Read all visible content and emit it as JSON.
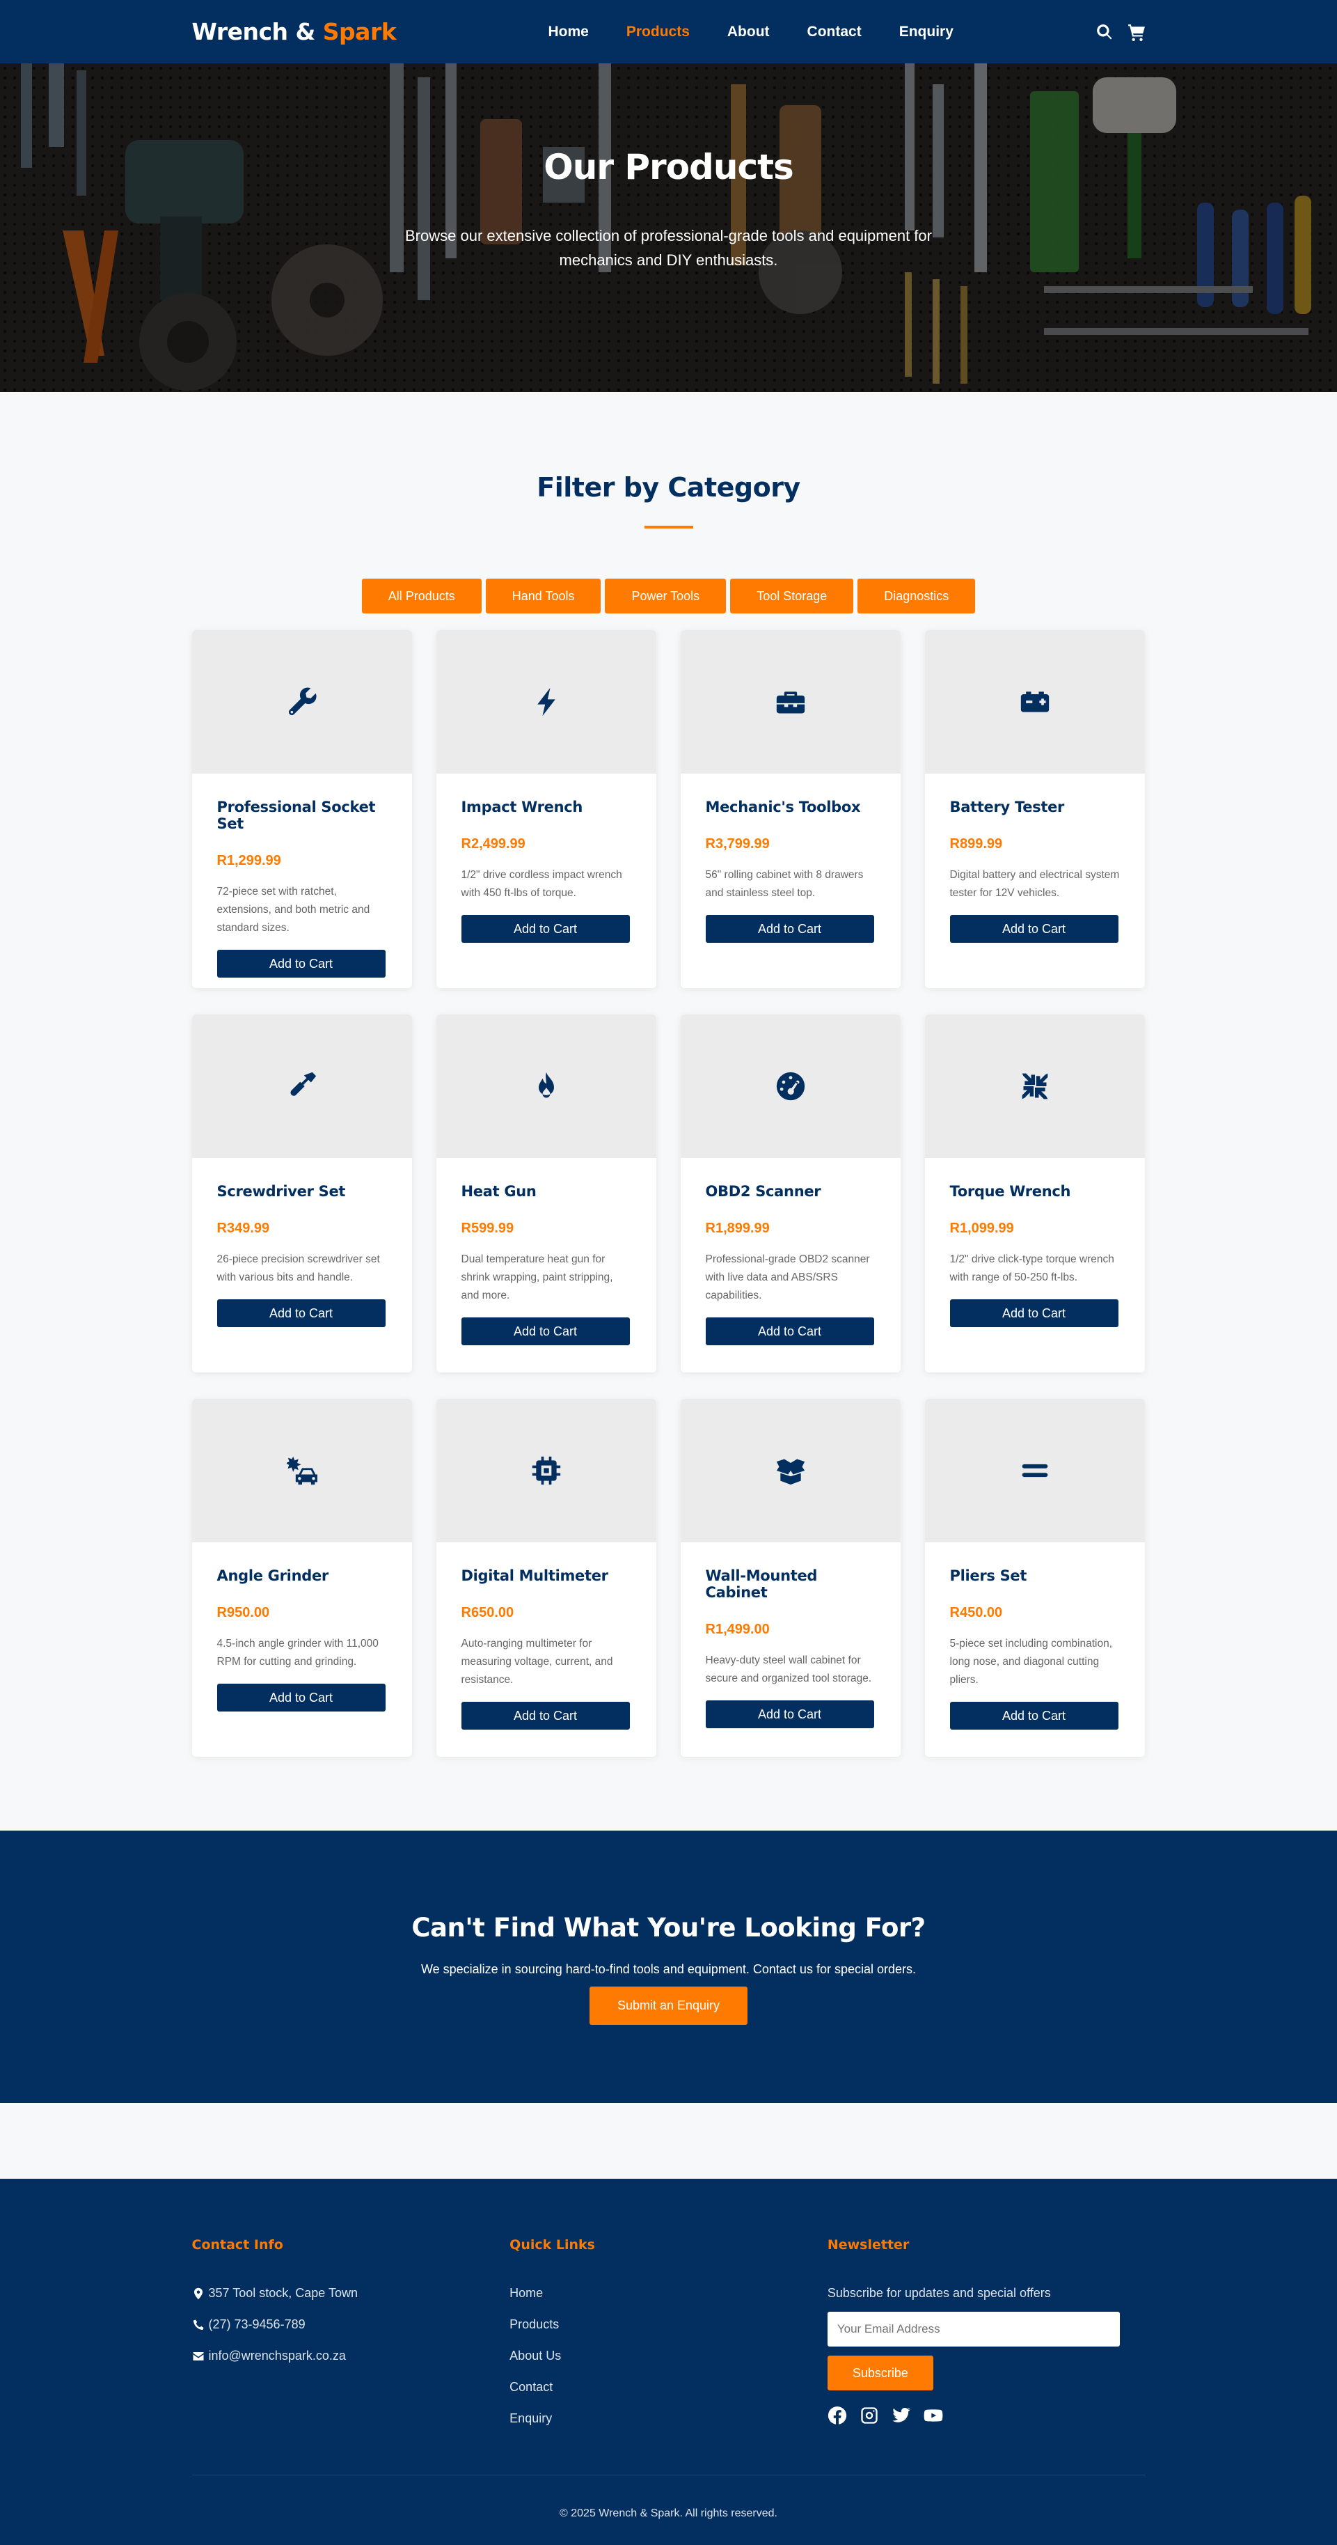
{
  "brand": {
    "name_part1": "Wrench & ",
    "name_part2": "Spark"
  },
  "nav": {
    "items": [
      {
        "label": "Home"
      },
      {
        "label": "Products"
      },
      {
        "label": "About"
      },
      {
        "label": "Contact"
      },
      {
        "label": "Enquiry"
      }
    ],
    "active": "Products"
  },
  "hero": {
    "title": "Our Products",
    "subtitle": "Browse our extensive collection of professional-grade tools and equipment for mechanics and DIY enthusiasts."
  },
  "filter": {
    "title": "Filter by Category",
    "buttons": [
      "All Products",
      "Hand Tools",
      "Power Tools",
      "Tool Storage",
      "Diagnostics"
    ]
  },
  "products": [
    {
      "name": "Professional Socket Set",
      "price": "R1,299.99",
      "desc": "72-piece set with ratchet, extensions, and both metric and standard sizes.",
      "icon": "wrench-icon",
      "button": "Add to Cart"
    },
    {
      "name": "Impact Wrench",
      "price": "R2,499.99",
      "desc": "1/2\" drive cordless impact wrench with 450 ft-lbs of torque.",
      "icon": "bolt-icon",
      "button": "Add to Cart"
    },
    {
      "name": "Mechanic's Toolbox",
      "price": "R3,799.99",
      "desc": "56\" rolling cabinet with 8 drawers and stainless steel top.",
      "icon": "toolbox-icon",
      "button": "Add to Cart"
    },
    {
      "name": "Battery Tester",
      "price": "R899.99",
      "desc": "Digital battery and electrical system tester for 12V vehicles.",
      "icon": "car-battery-icon",
      "button": "Add to Cart"
    },
    {
      "name": "Screwdriver Set",
      "price": "R349.99",
      "desc": "26-piece precision screwdriver set with various bits and handle.",
      "icon": "screwdriver-icon",
      "button": "Add to Cart"
    },
    {
      "name": "Heat Gun",
      "price": "R599.99",
      "desc": "Dual temperature heat gun for shrink wrapping, paint stripping, and more.",
      "icon": "fire-icon",
      "button": "Add to Cart"
    },
    {
      "name": "OBD2 Scanner",
      "price": "R1,899.99",
      "desc": "Professional-grade OBD2 scanner with live data and ABS/SRS capabilities.",
      "icon": "gauge-icon",
      "button": "Add to Cart"
    },
    {
      "name": "Torque Wrench",
      "price": "R1,099.99",
      "desc": "1/2\" drive click-type torque wrench with range of 50-250 ft-lbs.",
      "icon": "compress-icon",
      "button": "Add to Cart"
    },
    {
      "name": "Angle Grinder",
      "price": "R950.00",
      "desc": "4.5-inch angle grinder with 11,000 RPM for cutting and grinding.",
      "icon": "car-burst-icon",
      "button": "Add to Cart"
    },
    {
      "name": "Digital Multimeter",
      "price": "R650.00",
      "desc": "Auto-ranging multimeter for measuring voltage, current, and resistance.",
      "icon": "microchip-icon",
      "button": "Add to Cart"
    },
    {
      "name": "Wall-Mounted Cabinet",
      "price": "R1,499.00",
      "desc": "Heavy-duty steel wall cabinet for secure and organized tool storage.",
      "icon": "box-open-icon",
      "button": "Add to Cart"
    },
    {
      "name": "Pliers Set",
      "price": "R450.00",
      "desc": "5-piece set including combination, long nose, and diagonal cutting pliers.",
      "icon": "equals-icon",
      "button": "Add to Cart"
    }
  ],
  "cta": {
    "title": "Can't Find What You're Looking For?",
    "text": "We specialize in sourcing hard-to-find tools and equipment. Contact us for special orders.",
    "button": "Submit an Enquiry"
  },
  "footer": {
    "contact": {
      "title": "Contact Info",
      "address": "357 Tool stock, Cape Town",
      "phone": "(27) 73-9456-789",
      "email": "info@wrenchspark.co.za"
    },
    "links": {
      "title": "Quick Links",
      "items": [
        "Home",
        "Products",
        "About Us",
        "Contact",
        "Enquiry"
      ]
    },
    "newsletter": {
      "title": "Newsletter",
      "text": "Subscribe for updates and special offers",
      "placeholder": "Your Email Address",
      "button": "Subscribe"
    },
    "copyright": "© 2025 Wrench & Spark. All rights reserved."
  },
  "colors": {
    "navy": "#022f5f",
    "orange": "#ff7a00",
    "card_image_bg": "#ebebeb"
  }
}
